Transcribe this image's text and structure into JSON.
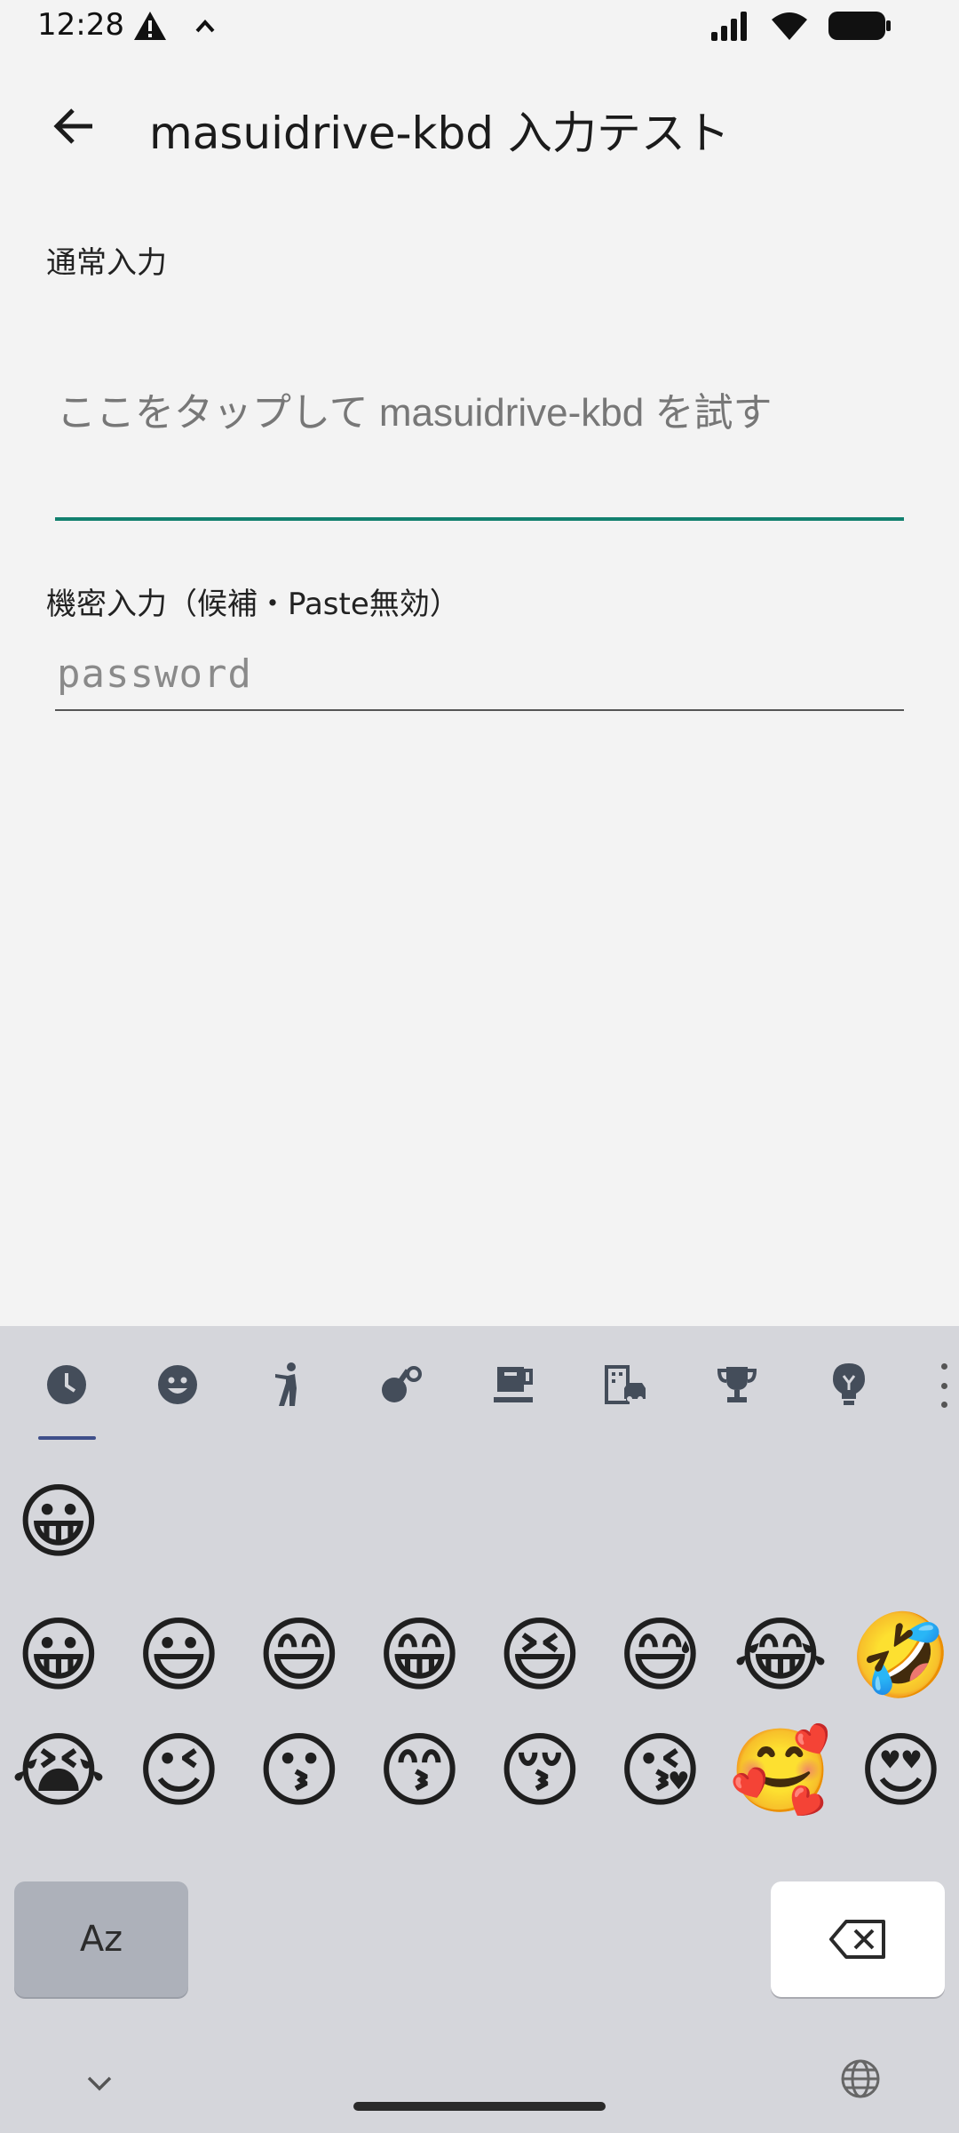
{
  "status_bar": {
    "time": "12:28",
    "left_icons": [
      "warning-icon",
      "caret-up-icon"
    ],
    "right_icons": [
      "signal-icon",
      "wifi-icon",
      "battery-icon"
    ]
  },
  "app_bar": {
    "title": "masuidrive-kbd 入力テスト",
    "back_icon": "back-arrow-icon"
  },
  "form": {
    "normal_label": "通常入力",
    "normal_placeholder": "ここをタップして masuidrive-kbd を試す",
    "secret_label": "機密入力（候補・Paste無効）",
    "secret_placeholder": "password",
    "accent_color": "#12806f"
  },
  "keyboard": {
    "categories": [
      "recent-clock-icon",
      "smiley-icon",
      "person-icon",
      "activity-icon",
      "food-drink-icon",
      "travel-building-icon",
      "trophy-icon",
      "lightbulb-icon"
    ],
    "recent_emojis": [
      "😀"
    ],
    "emoji_row_1": [
      "😀",
      "😃",
      "😄",
      "😁",
      "😆",
      "😅",
      "😂",
      "🤣"
    ],
    "emoji_row_2": [
      "😭",
      "😉",
      "😗",
      "😙",
      "😚",
      "😘",
      "🥰",
      "😍"
    ],
    "abc_key_label": "Az",
    "delete_icon": "backspace-icon",
    "hide_icon": "chevron-down-icon",
    "globe_icon": "globe-icon"
  }
}
